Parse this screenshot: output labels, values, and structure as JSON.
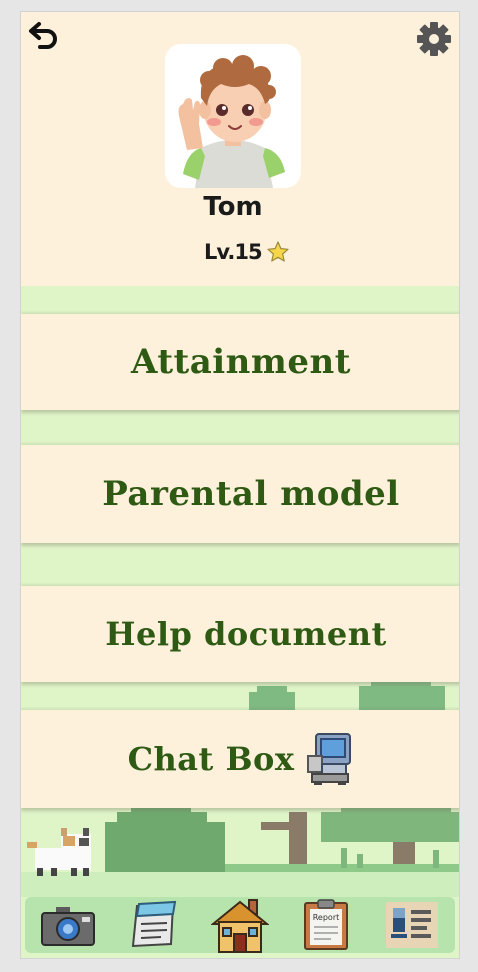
{
  "header": {
    "back_icon": "undo-arrow-icon",
    "settings_icon": "gear-icon",
    "avatar_icon": "child-avatar-waving",
    "user_name": "Tom",
    "level_label": "Lv.15",
    "level_icon": "star-icon"
  },
  "menu": {
    "items": [
      {
        "label": "Attainment"
      },
      {
        "label": "Parental model"
      },
      {
        "label": "Help document"
      },
      {
        "label": "Chat Box",
        "icon": "robot-icon"
      }
    ]
  },
  "bottom_nav": {
    "items": [
      {
        "icon": "camera-icon"
      },
      {
        "icon": "notepad-icon"
      },
      {
        "icon": "house-icon"
      },
      {
        "icon": "report-clipboard-icon",
        "label": "Report"
      },
      {
        "icon": "id-card-icon"
      }
    ]
  },
  "colors": {
    "cream": "#fdf1dc",
    "light_green": "#dff5c8",
    "dark_green_text": "#2e5a14",
    "nav_green": "#b7e3ad"
  }
}
